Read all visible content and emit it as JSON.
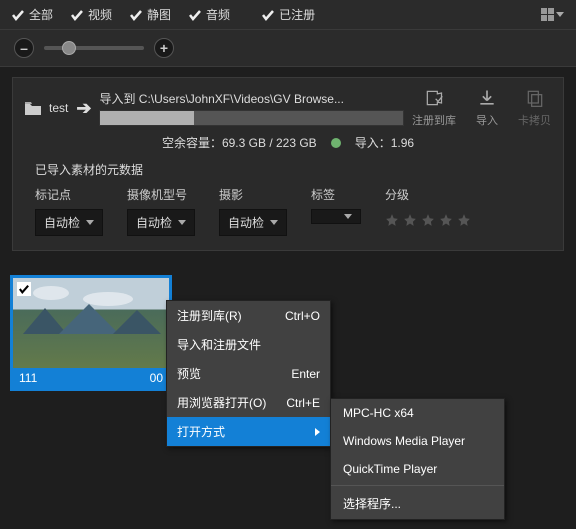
{
  "filters": {
    "all": "全部",
    "video": "视频",
    "still": "静图",
    "audio": "音频",
    "registered": "已注册"
  },
  "import": {
    "folder": "test",
    "path_label": "导入到 C:\\Users\\JohnXF\\Videos\\GV Browse...",
    "space_info": "空余容量：69.3 GB / 223 GB",
    "import_ratio_label": "导入：1.96",
    "actions": {
      "register": "注册到库",
      "import": "导入",
      "copy": "卡拷贝"
    }
  },
  "metadata": {
    "title": "已导入素材的元数据",
    "marker": {
      "label": "标记点",
      "value": "自动检"
    },
    "camera": {
      "label": "摄像机型号",
      "value": "自动检"
    },
    "shoot": {
      "label": "摄影",
      "value": "自动检"
    },
    "tag": {
      "label": "标签"
    },
    "rating": {
      "label": "分级"
    }
  },
  "thumbnail": {
    "name": "111",
    "time": "00"
  },
  "context_menu": {
    "register": {
      "label": "注册到库(R)",
      "shortcut": "Ctrl+O"
    },
    "import_reg": {
      "label": "导入和注册文件"
    },
    "preview": {
      "label": "预览",
      "shortcut": "Enter"
    },
    "open_browser": {
      "label": "用浏览器打开(O)",
      "shortcut": "Ctrl+E"
    },
    "open_with": {
      "label": "打开方式"
    }
  },
  "submenu": {
    "mpc": "MPC-HC x64",
    "wmp": "Windows Media Player",
    "qt": "QuickTime Player",
    "choose": "选择程序..."
  }
}
